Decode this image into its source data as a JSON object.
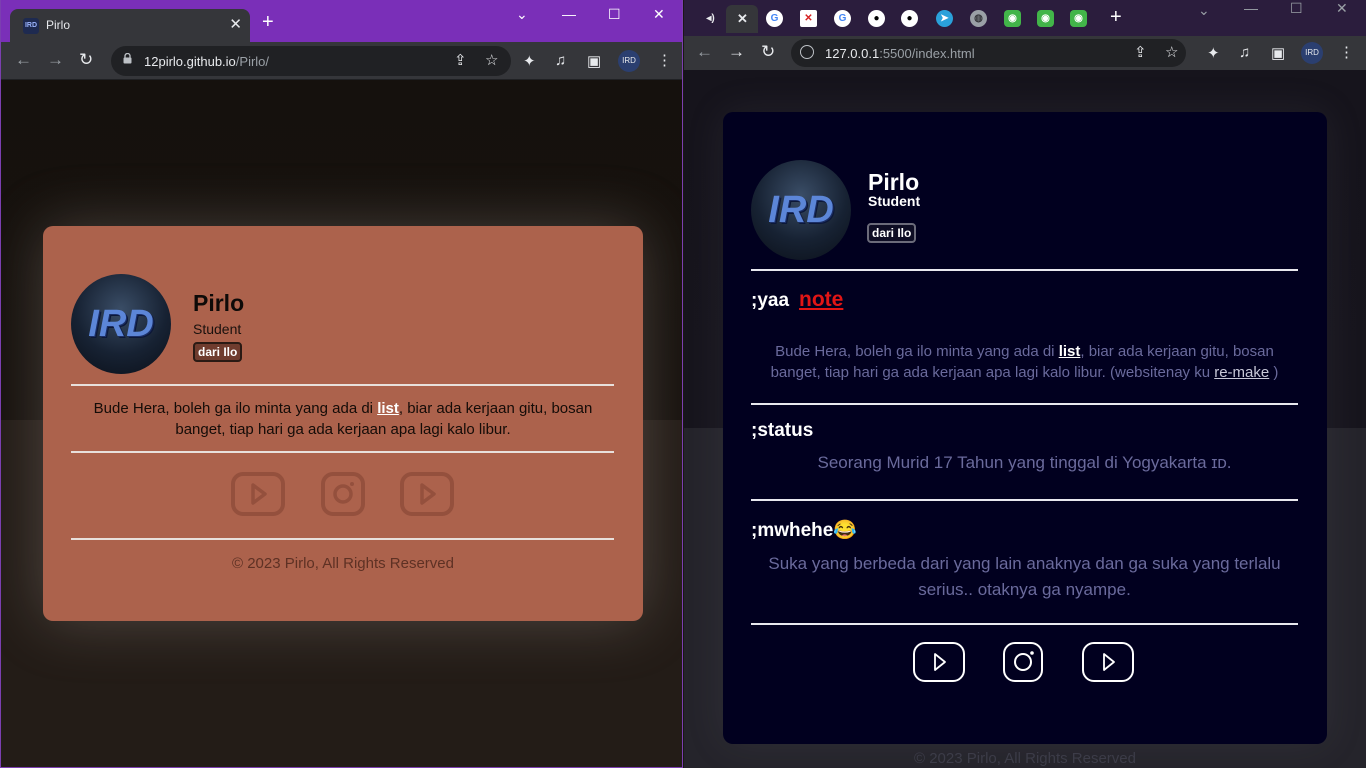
{
  "left_browser": {
    "tab_title": "Pirlo",
    "url_host": "12pirlo.github.io",
    "url_path": "/Pirlo/",
    "profile": {
      "name": "Pirlo",
      "role": "Student",
      "tag": "dari Ilo"
    },
    "desc_before": "Bude Hera, boleh ga ilo minta yang ada di ",
    "desc_link": "list",
    "desc_after": ", biar ada kerjaan gitu, bosan banget, tiap hari ga ada kerjaan apa lagi kalo libur.",
    "footer": "© 2023 Pirlo, All Rights Reserved"
  },
  "right_browser": {
    "url_host": "127.0.0.1",
    "url_path": ":5500/index.html",
    "profile": {
      "name": "Pirlo",
      "role": "Student",
      "tag": "dari Ilo"
    },
    "section_yaa": {
      "heading": ";yaa",
      "note_link": "note",
      "text_before": "Bude Hera, boleh ga ilo minta yang ada di ",
      "text_link": "list",
      "text_middle": ", biar ada kerjaan gitu, bosan banget, tiap hari ga ada kerjaan apa lagi kalo libur. (websitenay ku ",
      "text_link2": "re-make",
      "text_after": " )"
    },
    "section_status": {
      "heading": ";status",
      "text": "Seorang Murid 17 Tahun yang tinggal di Yogyakarta ɪᴅ."
    },
    "section_mwhehe": {
      "heading": ";mwhehe😂",
      "text": "Suka yang berbeda dari yang lain anaknya dan ga suka yang terlalu serius.. otaknya ga nyampe."
    },
    "footer": "© 2023 Pirlo, All Rights Reserved"
  },
  "icons": {
    "social": [
      "youtube-icon",
      "instagram-icon",
      "youtube-icon"
    ]
  }
}
